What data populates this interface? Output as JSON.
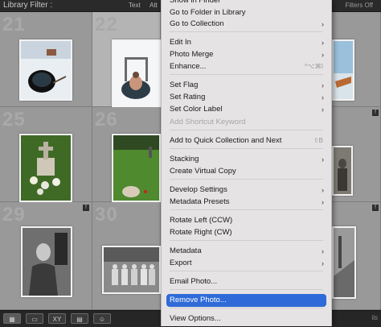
{
  "filter_bar": {
    "title": "Library Filter :",
    "text_tab": "Text",
    "attr_tab": "Att",
    "filters_off": "Filters Off"
  },
  "grid": {
    "cells": [
      {
        "num": "21",
        "selected": false,
        "photo": "snow-hole"
      },
      {
        "num": "22",
        "selected": true,
        "photo": "ice-swimmer"
      },
      {
        "num": "",
        "selected": false,
        "photo": "boat-shore"
      },
      {
        "num": "25",
        "selected": false,
        "photo": "grave-flowers"
      },
      {
        "num": "26",
        "selected": false,
        "photo": "cemetery-green"
      },
      {
        "num": "",
        "selected": false,
        "photo": "old-photo-right"
      },
      {
        "num": "29",
        "selected": false,
        "photo": "portrait-man"
      },
      {
        "num": "30",
        "selected": false,
        "photo": "group-photo"
      },
      {
        "num": "",
        "selected": false,
        "photo": "street-right"
      }
    ],
    "badge": "!",
    "dots": "• • • • •"
  },
  "context_menu": {
    "items": [
      {
        "label": "Show in Finder",
        "arrow": false,
        "shortcut": "",
        "disabled": false,
        "highlight": false
      },
      {
        "label": "Go to Folder in Library",
        "arrow": false,
        "shortcut": "",
        "disabled": false,
        "highlight": false
      },
      {
        "label": "Go to Collection",
        "arrow": true,
        "shortcut": "",
        "disabled": false,
        "highlight": false
      },
      {
        "label": "Edit In",
        "arrow": true,
        "shortcut": "",
        "disabled": false,
        "highlight": false
      },
      {
        "label": "Photo Merge",
        "arrow": true,
        "shortcut": "",
        "disabled": false,
        "highlight": false
      },
      {
        "label": "Enhance...",
        "arrow": false,
        "shortcut": "^⌥⌘I",
        "disabled": false,
        "highlight": false
      },
      {
        "label": "Set Flag",
        "arrow": true,
        "shortcut": "",
        "disabled": false,
        "highlight": false
      },
      {
        "label": "Set Rating",
        "arrow": true,
        "shortcut": "",
        "disabled": false,
        "highlight": false
      },
      {
        "label": "Set Color Label",
        "arrow": true,
        "shortcut": "",
        "disabled": false,
        "highlight": false
      },
      {
        "label": "Add Shortcut Keyword",
        "arrow": false,
        "shortcut": "",
        "disabled": true,
        "highlight": false
      },
      {
        "label": "Add to Quick Collection and Next",
        "arrow": false,
        "shortcut": "⇧B",
        "disabled": false,
        "highlight": false
      },
      {
        "label": "Stacking",
        "arrow": true,
        "shortcut": "",
        "disabled": false,
        "highlight": false
      },
      {
        "label": "Create Virtual Copy",
        "arrow": false,
        "shortcut": "",
        "disabled": false,
        "highlight": false
      },
      {
        "label": "Develop Settings",
        "arrow": true,
        "shortcut": "",
        "disabled": false,
        "highlight": false
      },
      {
        "label": "Metadata Presets",
        "arrow": true,
        "shortcut": "",
        "disabled": false,
        "highlight": false
      },
      {
        "label": "Rotate Left (CCW)",
        "arrow": false,
        "shortcut": "",
        "disabled": false,
        "highlight": false
      },
      {
        "label": "Rotate Right (CW)",
        "arrow": false,
        "shortcut": "",
        "disabled": false,
        "highlight": false
      },
      {
        "label": "Metadata",
        "arrow": true,
        "shortcut": "",
        "disabled": false,
        "highlight": false
      },
      {
        "label": "Export",
        "arrow": true,
        "shortcut": "",
        "disabled": false,
        "highlight": false
      },
      {
        "label": "Email Photo...",
        "arrow": false,
        "shortcut": "",
        "disabled": false,
        "highlight": false
      },
      {
        "label": "Remove Photo...",
        "arrow": false,
        "shortcut": "",
        "disabled": false,
        "highlight": true
      },
      {
        "label": "View Options...",
        "arrow": false,
        "shortcut": "",
        "disabled": false,
        "highlight": false
      }
    ],
    "arrow_glyph": "›"
  },
  "toolbar": {
    "grid_view": "▦",
    "loupe_view": "▭",
    "compare_view": "XY",
    "survey_view": "▤",
    "people_view": "☺",
    "right_text": "ils"
  },
  "colors": {
    "highlight": "#2f6bd8",
    "menu_bg": "#e5e3e3",
    "grid_cell": "#999999"
  }
}
